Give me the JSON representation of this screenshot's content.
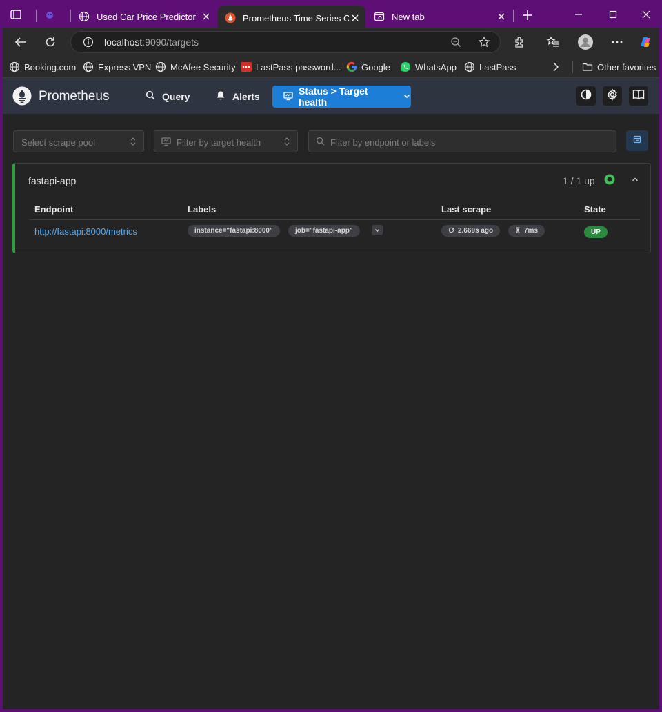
{
  "browser": {
    "tabs": [
      {
        "title": "Used Car Price Predictor",
        "icon": "globe-icon"
      },
      {
        "title": "Prometheus Time Series Colle",
        "icon": "prometheus-icon",
        "active": true
      },
      {
        "title": "New tab",
        "icon": "newtab-icon"
      }
    ],
    "address": {
      "host": "localhost",
      "rest": ":9090/targets"
    },
    "bookmarks": [
      {
        "label": "Booking.com",
        "icon": "globe-icon"
      },
      {
        "label": "Express VPN",
        "icon": "globe-icon"
      },
      {
        "label": "McAfee Security",
        "icon": "globe-icon"
      },
      {
        "label": "LastPass password...",
        "icon": "lastpass-icon"
      },
      {
        "label": "Google",
        "icon": "google-icon"
      },
      {
        "label": "WhatsApp",
        "icon": "whatsapp-icon"
      },
      {
        "label": "LastPass",
        "icon": "globe-icon"
      }
    ],
    "other_favorites": "Other favorites"
  },
  "app": {
    "brand": "Prometheus",
    "nav": {
      "query": "Query",
      "alerts": "Alerts",
      "status": "Status > Target health"
    },
    "filters": {
      "scrape_pool_placeholder": "Select scrape pool",
      "health_placeholder": "Filter by target health",
      "search_placeholder": "Filter by endpoint or labels"
    },
    "pool": {
      "name": "fastapi-app",
      "count": "1 / 1 up",
      "columns": {
        "endpoint": "Endpoint",
        "labels": "Labels",
        "last_scrape": "Last scrape",
        "state": "State"
      },
      "targets": [
        {
          "endpoint": "http://fastapi:8000/metrics",
          "labels": [
            "instance=\"fastapi:8000\"",
            "job=\"fastapi-app\""
          ],
          "last_scrape_ago": "2.669s ago",
          "scrape_duration": "7ms",
          "state": "UP"
        }
      ]
    }
  },
  "colors": {
    "accent": "#1c7ed6",
    "up_green": "#2f9e44",
    "link": "#4dabf7",
    "browser_frame": "#5d0f75"
  }
}
